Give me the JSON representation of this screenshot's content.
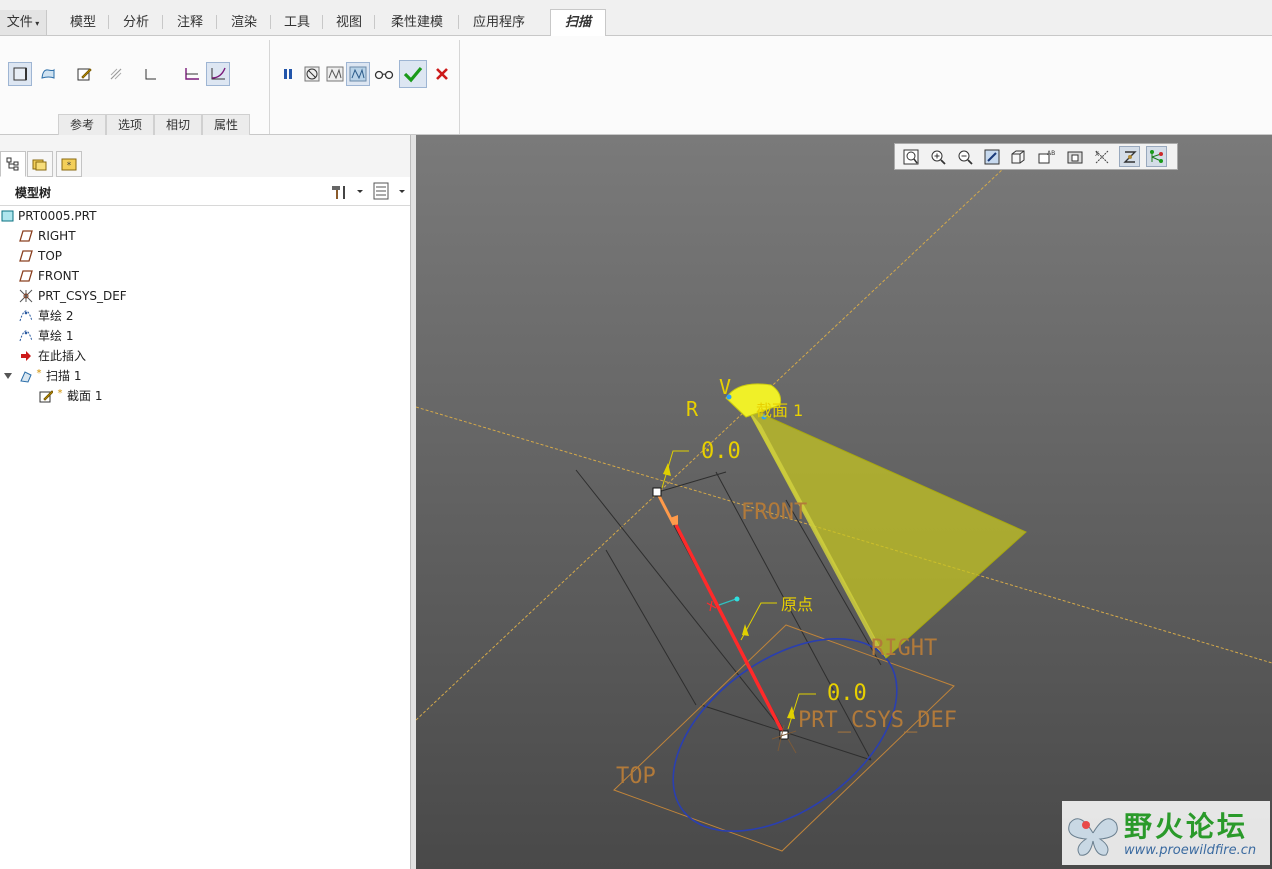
{
  "ribbon": {
    "file_tab": "文件",
    "tabs": [
      "模型",
      "分析",
      "注释",
      "渲染",
      "工具",
      "视图",
      "柔性建模",
      "应用程序"
    ],
    "active_tab": "扫描",
    "groups": [
      "参考",
      "选项",
      "相切",
      "属性"
    ]
  },
  "tree": {
    "title": "模型树",
    "items": [
      {
        "label": "PRT0005.PRT",
        "icon": "part-icon"
      },
      {
        "label": "RIGHT",
        "icon": "datum-plane-icon"
      },
      {
        "label": "TOP",
        "icon": "datum-plane-icon"
      },
      {
        "label": "FRONT",
        "icon": "datum-plane-icon"
      },
      {
        "label": "PRT_CSYS_DEF",
        "icon": "csys-icon"
      },
      {
        "label": "草绘 2",
        "icon": "sketch-icon"
      },
      {
        "label": "草绘 1",
        "icon": "sketch-icon"
      },
      {
        "label": "在此插入",
        "icon": "insert-here-arrow-icon"
      },
      {
        "label": "扫描 1",
        "icon": "sweep-icon"
      },
      {
        "label": "截面 1",
        "icon": "section-icon"
      }
    ]
  },
  "viewport": {
    "labels": {
      "trajectory_start_value": "0.0",
      "origin_value": "0.0",
      "origin_label": "原点",
      "front": "FRONT",
      "right": "RIGHT",
      "top": "TOP",
      "csys": "PRT_CSYS_DEF",
      "top_fragment_r": "R",
      "top_fragment_v": "V",
      "top_fragment_section": "截面 1"
    }
  },
  "watermark": {
    "brand": "野火论坛",
    "url": "www.proewildfire.cn"
  },
  "colors": {
    "datum_plane": "#c0843a",
    "datum_axis": "#d4a94a",
    "trajectory": "#ff2a2a",
    "sweep_preview": "#d8d820",
    "sketch_circle": "#2a3fb0",
    "confirm": "#1a9a1a",
    "cancel": "#cc1a1a"
  }
}
